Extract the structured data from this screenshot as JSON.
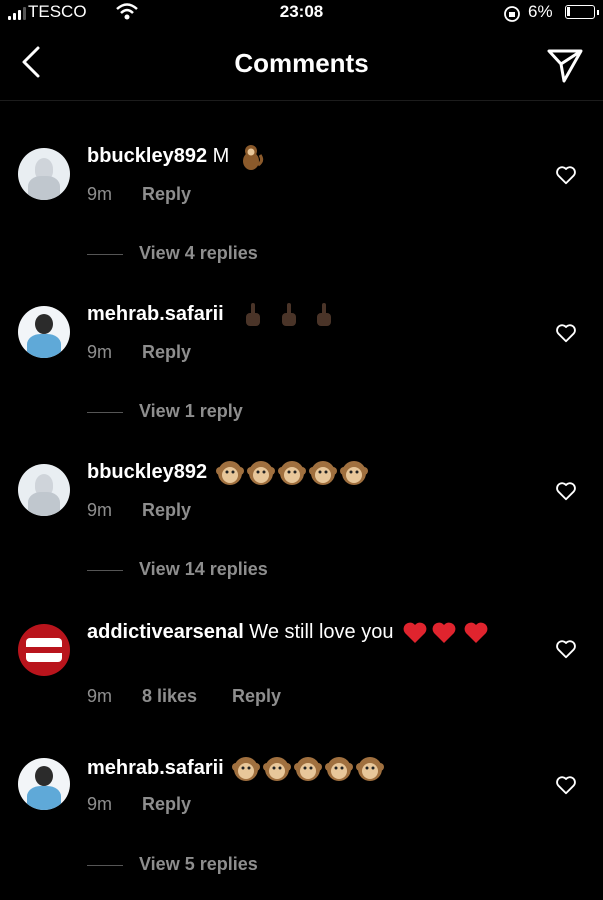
{
  "status_bar": {
    "carrier": "TESCO",
    "time": "23:08",
    "battery": "6%"
  },
  "header": {
    "title": "Comments"
  },
  "comments": [
    {
      "username": "bbuckley892",
      "text": " M",
      "emojis": [
        "monkey-emoji"
      ],
      "time": "9m",
      "likes": "",
      "reply_label": "Reply",
      "view_replies": "View 4 replies",
      "avatar": "person-white"
    },
    {
      "username": "mehrab.safarii",
      "text": "",
      "emojis": [
        "middle-finger-emoji",
        "middle-finger-emoji",
        "middle-finger-emoji"
      ],
      "time": "9m",
      "likes": "",
      "reply_label": "Reply",
      "view_replies": "View 1 reply",
      "avatar": "person-blue"
    },
    {
      "username": "bbuckley892",
      "text": "",
      "emojis": [
        "monkey-face-emoji",
        "monkey-face-emoji",
        "monkey-face-emoji",
        "monkey-face-emoji",
        "monkey-face-emoji"
      ],
      "time": "9m",
      "likes": "",
      "reply_label": "Reply",
      "view_replies": "View 14 replies",
      "avatar": "person-white"
    },
    {
      "username": "addictivearsenal",
      "text": " We still love you",
      "emojis": [
        "red-heart-emoji",
        "red-heart-emoji",
        "red-heart-emoji"
      ],
      "time": "9m",
      "likes": "8 likes",
      "reply_label": "Reply",
      "view_replies": "",
      "avatar": "club-badge"
    },
    {
      "username": "mehrab.safarii",
      "text": "",
      "emojis": [
        "monkey-face-emoji",
        "monkey-face-emoji",
        "monkey-face-emoji",
        "monkey-face-emoji",
        "monkey-face-emoji"
      ],
      "time": "9m",
      "likes": "",
      "reply_label": "Reply",
      "view_replies": "View 5 replies",
      "avatar": "person-blue"
    }
  ],
  "colors": {
    "background": "#000000",
    "secondary_text": "#8e8e8e",
    "heart_red": "#e0242e",
    "monkey_face": "#e8c79a"
  }
}
